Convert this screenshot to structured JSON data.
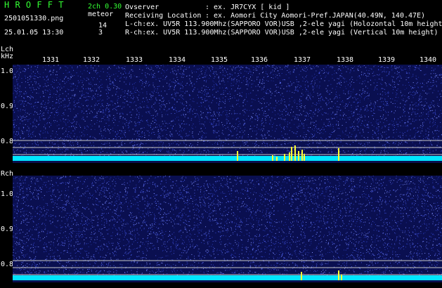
{
  "header": {
    "app_title": "H R O F F T",
    "mode": "2ch 0.30",
    "filename": "2501051330.png",
    "meteor_label": "meteor",
    "datetime": "25.01.05 13:30",
    "lch_count": "14",
    "rch_count": "3",
    "observer_label": "Ovserver",
    "observer_value": ": ex. JR7CYX [ kid ]",
    "location_label": "Receiving Location",
    "location_value": ": ex. Aomori City Aomori-Pref.JAPAN(40.49N, 140.47E)",
    "lch_info": "L-ch:ex. UV5R 113.900Mhz(SAPPORO VOR)USB ,2-ele yagi (Holozontal 10m height",
    "rch_info": "R-ch:ex. UV5R 113.900Mhz(SAPPORO VOR)USB ,2-ele yagi (Vertical 10m height)"
  },
  "lch": {
    "label": "Lch",
    "unit": "kHz",
    "time_ticks": [
      "1331",
      "1332",
      "1333",
      "1334",
      "1335",
      "1336",
      "1337",
      "1338",
      "1339",
      "1340"
    ],
    "freq_ticks": [
      "1.0",
      "0.9",
      "0.8"
    ]
  },
  "rch": {
    "label": "Rch",
    "freq_ticks": [
      "1.0",
      "0.9",
      "0.8"
    ]
  },
  "colors": {
    "background": "#000000",
    "text_green": "#33ff33",
    "noise_blue": "#2233aa",
    "baseline_cyan": "#00e5ff",
    "echo_yellow": "#ffff33",
    "gridline": "#c8c8c8"
  }
}
